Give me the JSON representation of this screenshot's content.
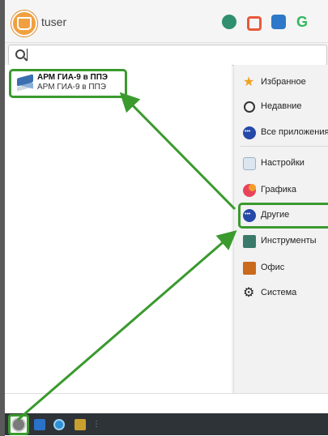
{
  "header": {
    "username": "tuser",
    "icons": [
      "tree-icon",
      "lock-icon",
      "sync-icon",
      "g-icon"
    ]
  },
  "search": {
    "placeholder": "",
    "value": ""
  },
  "app": {
    "name": "АРМ ГИА-9 в ППЭ",
    "description": "АРМ ГИА-9 в ППЭ",
    "icon": "layers-icon"
  },
  "categories": [
    {
      "label": "Избранное",
      "icon": "star-icon"
    },
    {
      "label": "Недавние",
      "icon": "clock-icon"
    },
    {
      "label": "Все приложения",
      "icon": "dots-icon"
    },
    {
      "label": "Настройки",
      "icon": "settings-icon"
    },
    {
      "label": "Графика",
      "icon": "graphics-icon"
    },
    {
      "label": "Другие",
      "icon": "dots-icon",
      "selected": true
    },
    {
      "label": "Инструменты",
      "icon": "tools-icon"
    },
    {
      "label": "Офис",
      "icon": "briefcase-icon"
    },
    {
      "label": "Система",
      "icon": "gear-icon"
    }
  ],
  "taskbar": {
    "icons": [
      "start-menu-icon",
      "desktop-icon",
      "browser-icon",
      "file-manager-icon"
    ],
    "overflow": "⋮"
  },
  "colors": {
    "highlight": "#3a9a2e",
    "accent_orange": "#f0a040"
  }
}
